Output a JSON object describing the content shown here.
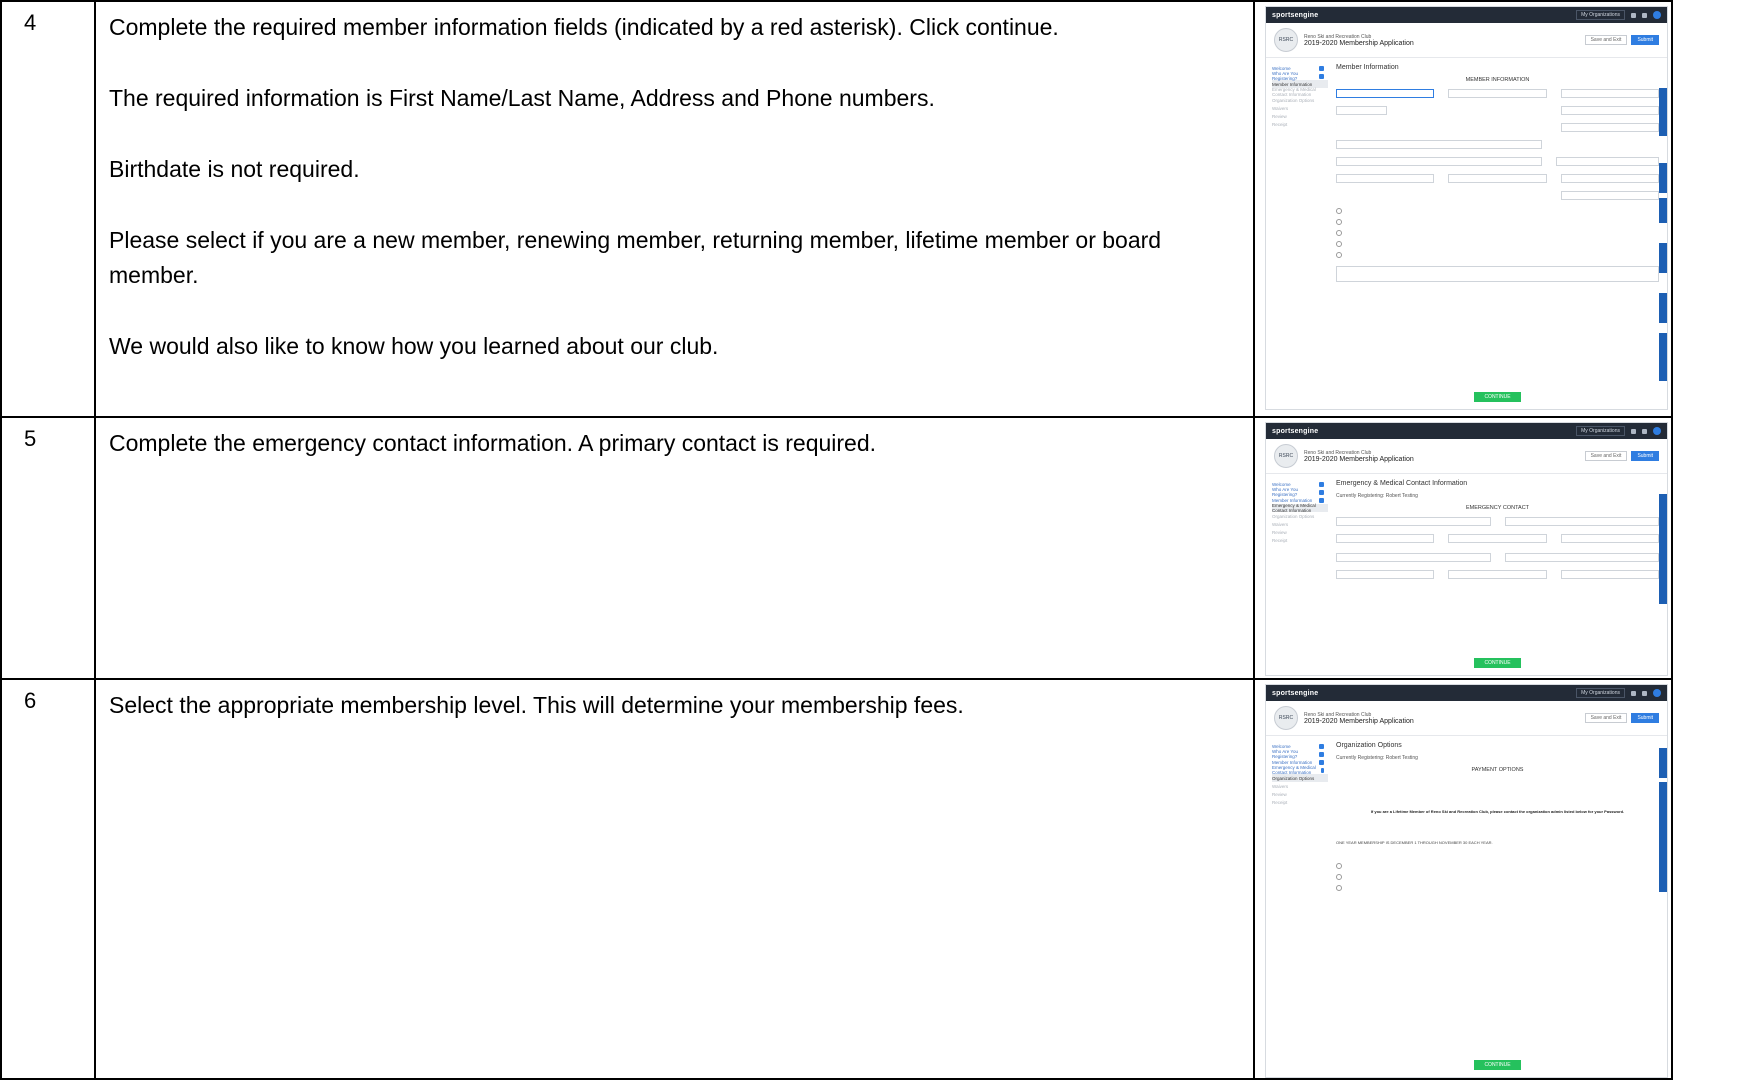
{
  "rows": [
    {
      "step": "4",
      "paragraphs": [
        "Complete the required member information fields (indicated by a red asterisk).  Click continue.",
        "The required information is First Name/Last Name, Address and Phone numbers.",
        "Birthdate is not required.",
        "Please select if you are a new member, renewing member, returning member, lifetime member or board member.",
        "We would also like to know how you learned about our club."
      ]
    },
    {
      "step": "5",
      "paragraphs": [
        "Complete the emergency contact information.  A primary contact is required."
      ]
    },
    {
      "step": "6",
      "paragraphs": [
        "Select the appropriate membership level.  This will determine your membership fees."
      ]
    }
  ],
  "mini": {
    "logo": "sportsengine",
    "org_button": "My Organizations",
    "org_name": "Reno Ski and Recreation Club",
    "app_title": "2019-2020 Membership Application",
    "save_button": "Save and Exit",
    "submit_button": "Submit",
    "continue": "CONTINUE",
    "registering": "Currently Registering: Robert Testing",
    "sidebar": [
      "Welcome",
      "Who Are You Registering?",
      "Member Information",
      "Emergency & Medical Contact Information",
      "Organization Options",
      "Waivers",
      "Review",
      "Receipt"
    ],
    "s4": {
      "title": "Member Information",
      "heading": "MEMBER INFORMATION"
    },
    "s5": {
      "title": "Emergency & Medical Contact Information",
      "heading": "EMERGENCY CONTACT"
    },
    "s6": {
      "title": "Organization Options",
      "heading": "PAYMENT OPTIONS",
      "lifetime": "If you are a Lifetime Member of Reno Ski and Recreation Club, please contact the organization admin listed below for your Password.",
      "year": "ONE YEAR MEMBERSHIP IS DECEMBER 1 THROUGH NOVEMBER 30 EACH YEAR."
    }
  },
  "colors": {
    "topbar": "#232b37",
    "accent": "#2f7de1",
    "continue": "#25c15d"
  }
}
